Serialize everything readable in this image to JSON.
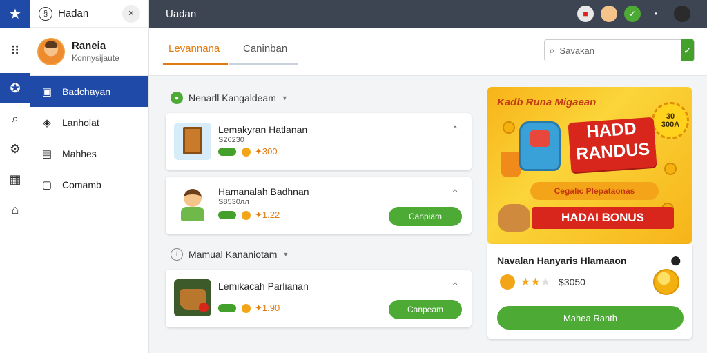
{
  "window": {
    "title": "Hadan"
  },
  "topbar": {
    "title": "Uadan"
  },
  "profile": {
    "name": "Raneia",
    "subtitle": "Konnysijaute"
  },
  "sidebar": {
    "items": [
      {
        "label": "Badchayan",
        "icon": "star-badge-icon",
        "active": true
      },
      {
        "label": "Lanholat",
        "icon": "tag-icon",
        "active": false
      },
      {
        "label": "Mahhes",
        "icon": "clipboard-icon",
        "active": false
      },
      {
        "label": "Comamb",
        "icon": "document-icon",
        "active": false
      }
    ]
  },
  "rail": {
    "icons": [
      "star-icon",
      "grid-icon",
      "star-badge-icon",
      "search-icon",
      "settings-icon",
      "calendar-icon",
      "home-icon"
    ]
  },
  "tabs": [
    {
      "label": "Levannana",
      "active": true
    },
    {
      "label": "Caninban",
      "active": false
    }
  ],
  "search": {
    "placeholder": "Savakan"
  },
  "sections": [
    {
      "title": "Nenarll Kangaldeam"
    },
    {
      "title": "Mamual Kananiotam"
    }
  ],
  "cards": [
    {
      "name": "Lemakyran Hatlanan",
      "sub": "Ѕ26230",
      "price": "✦300",
      "button": ""
    },
    {
      "name": "Hamanalah Badhnan",
      "sub": "Ѕ8530лл",
      "price": "✦1.22",
      "button": "Canpiam"
    },
    {
      "name": "Lemikacah Parlianan",
      "sub": "",
      "price": "✦1.90",
      "button": "Canpeam"
    }
  ],
  "promo": {
    "title": "Kadb Runa Migaean",
    "sun_line1": "30",
    "sun_line2": "300A",
    "headline_line1": "HADD",
    "headline_line2": "RANDUS",
    "ribbon": "Cegalic Plepataonas",
    "bonus": "HADAI BONUS"
  },
  "reward": {
    "title": "Navalan Hanyaris Hlamaaon",
    "rating": 2,
    "price": "$3050",
    "button": "Mahea Ranth"
  },
  "colors": {
    "primary": "#1f4aa8",
    "accent": "#e07b12",
    "green": "#4caa35",
    "topbar": "#3d4452"
  }
}
